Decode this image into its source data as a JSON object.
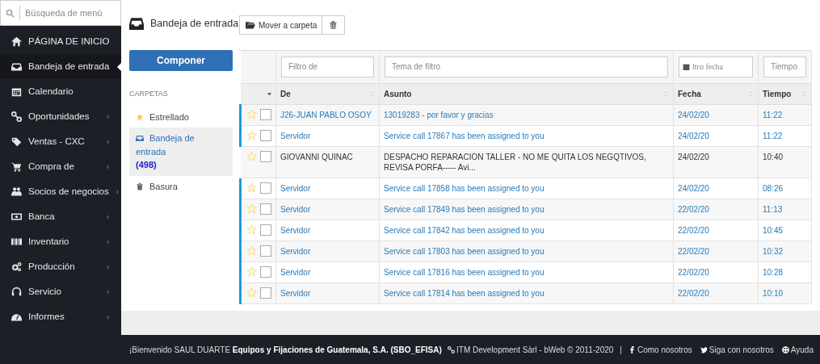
{
  "sidebar": {
    "search": {
      "placeholder": "Búsqueda de menú"
    },
    "items": [
      {
        "label": "PÁGINA DE INICIO",
        "selected": false,
        "submenu": false
      },
      {
        "label": "Bandeja de entrada",
        "selected": true,
        "submenu": false
      },
      {
        "label": "Calendario",
        "selected": false,
        "submenu": false
      },
      {
        "label": "Oportunidades",
        "selected": false,
        "submenu": true
      },
      {
        "label": "Ventas - CXC",
        "selected": false,
        "submenu": true
      },
      {
        "label": "Compra de",
        "selected": false,
        "submenu": true
      },
      {
        "label": "Socios de negocios",
        "selected": false,
        "submenu": true
      },
      {
        "label": "Banca",
        "selected": false,
        "submenu": true
      },
      {
        "label": "Inventario",
        "selected": false,
        "submenu": true
      },
      {
        "label": "Producción",
        "selected": false,
        "submenu": true
      },
      {
        "label": "Servicio",
        "selected": false,
        "submenu": true
      },
      {
        "label": "Informes",
        "selected": false,
        "submenu": true
      }
    ]
  },
  "page_title": "Bandeja de entrada",
  "toolbar": {
    "move_button": "Mover a carpeta"
  },
  "compose_button": "Componer",
  "folders": {
    "heading": "CARPETAS",
    "items": [
      {
        "label": "Estrellado",
        "selected": false
      },
      {
        "label": "Bandeja de entrada",
        "count": "(498)",
        "selected": true
      },
      {
        "label": "Basura",
        "selected": false
      }
    ]
  },
  "table": {
    "filters": {
      "from": {
        "placeholder": "Filtro de"
      },
      "subject": {
        "placeholder": "Tema de filtro"
      },
      "date": {
        "placeholder": "ltro fecha"
      },
      "time": {
        "placeholder": "Tiempo"
      }
    },
    "columns": [
      "De",
      "Asunto",
      "Fecha",
      "Tiempo"
    ],
    "rows": [
      {
        "from": "J26-JUAN PABLO OSOY",
        "subject": "13019283 - por favor y gracias",
        "date": "24/02/20",
        "time": "11:22",
        "unread": true
      },
      {
        "from": "Servidor",
        "subject": "Service call 17867 has been assigned to you",
        "date": "24/02/20",
        "time": "11:22",
        "unread": true
      },
      {
        "from": "GIOVANNI QUINAC",
        "subject": "DESPACHO REPARACION TALLER - NO ME QUITA LOS NEGQTIVOS, REVISA PORFA----- Avi...",
        "date": "24/02/20",
        "time": "10:40",
        "unread": false
      },
      {
        "from": "Servidor",
        "subject": "Service call 17858 has been assigned to you",
        "date": "24/02/20",
        "time": "08:26",
        "unread": true
      },
      {
        "from": "Servidor",
        "subject": "Service call 17849 has been assigned to you",
        "date": "22/02/20",
        "time": "11:13",
        "unread": true
      },
      {
        "from": "Servidor",
        "subject": "Service call 17842 has been assigned to you",
        "date": "22/02/20",
        "time": "10:45",
        "unread": true
      },
      {
        "from": "Servidor",
        "subject": "Service call 17803 has been assigned to you",
        "date": "22/02/20",
        "time": "10:32",
        "unread": true
      },
      {
        "from": "Servidor",
        "subject": "Service call 17816 has been assigned to you",
        "date": "22/02/20",
        "time": "10:28",
        "unread": true
      },
      {
        "from": "Servidor",
        "subject": "Service call 17814 has been assigned to you",
        "date": "22/02/20",
        "time": "10:10",
        "unread": true
      }
    ]
  },
  "footer": {
    "welcome": "¡Bienvenido SAUL DUARTE **Equipos y Fijaciones de Guatemala, S.A. (SBO_EFISA)**",
    "credit": "ITM Development Sàrl - bWeb © 2011-2020",
    "separator": "|",
    "links": [
      "Como nosotros",
      "Siga con nosotros",
      "Ayuda"
    ]
  }
}
